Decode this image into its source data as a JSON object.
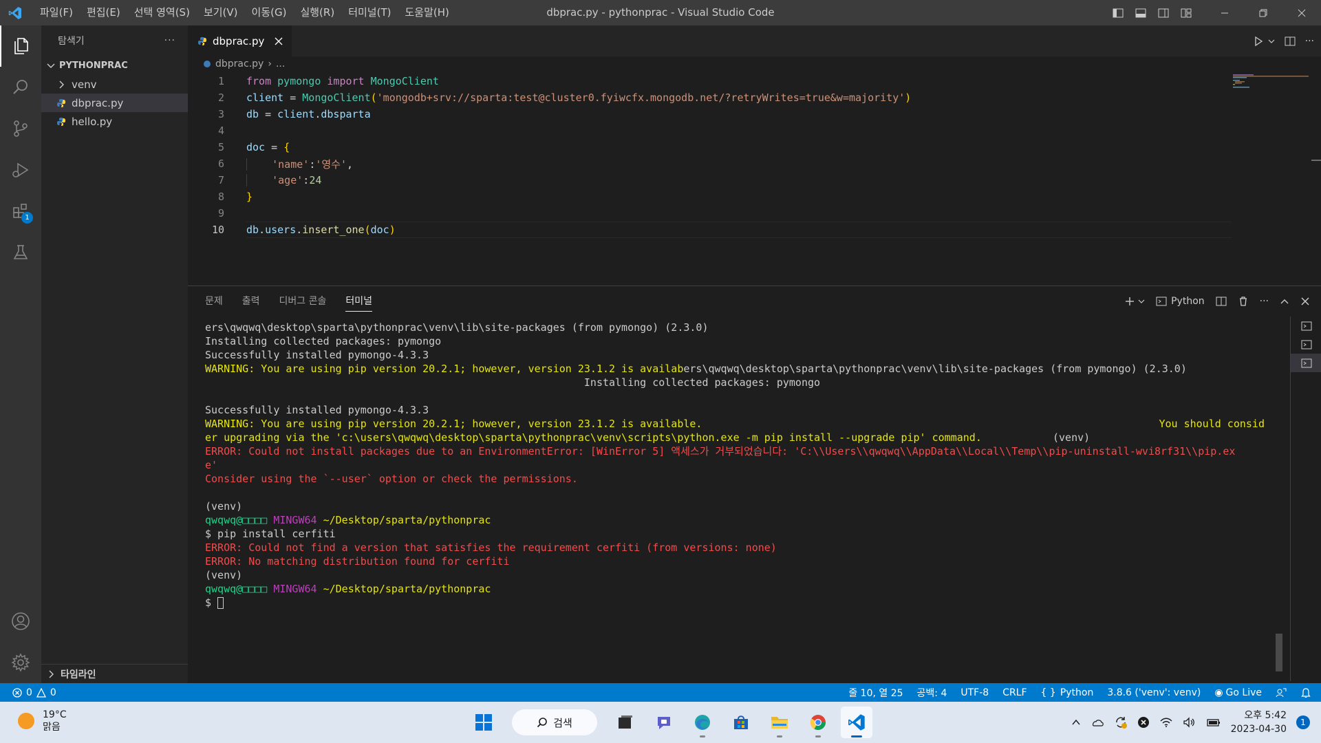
{
  "window": {
    "title": "dbprac.py - pythonprac - Visual Studio Code",
    "menu": [
      "파일(F)",
      "편집(E)",
      "선택 영역(S)",
      "보기(V)",
      "이동(G)",
      "실행(R)",
      "터미널(T)",
      "도움말(H)"
    ]
  },
  "activitybar": {
    "items": [
      "explorer-icon",
      "search-icon",
      "source-control-icon",
      "run-debug-icon",
      "extensions-icon",
      "testing-icon"
    ],
    "extensions_badge": "1",
    "bottom": [
      "accounts-icon",
      "manage-gear-icon"
    ]
  },
  "sidebar": {
    "title": "탐색기",
    "more": "···",
    "folder": "PYTHONPRAC",
    "items": [
      {
        "label": "venv",
        "type": "folder"
      },
      {
        "label": "dbprac.py",
        "type": "python-file",
        "selected": true
      },
      {
        "label": "hello.py",
        "type": "python-file"
      }
    ],
    "timeline": "타임라인"
  },
  "editor": {
    "tab": "dbprac.py",
    "breadcrumb": [
      "dbprac.py",
      "..."
    ],
    "line_numbers": [
      "1",
      "2",
      "3",
      "4",
      "5",
      "6",
      "7",
      "8",
      "9",
      "10"
    ],
    "current_line": 10,
    "code": {
      "l1": [
        "from",
        "pymongo",
        "import",
        "MongoClient"
      ],
      "l2": [
        "client",
        "=",
        "MongoClient",
        "(",
        "'mongodb+srv://sparta:test@cluster0.fyiwcfx.mongodb.net/?retryWrites=true&w=majority'",
        ")"
      ],
      "l3": [
        "db",
        "=",
        "client",
        ".",
        "dbsparta"
      ],
      "l5": [
        "doc",
        "=",
        "{"
      ],
      "l6": [
        "'name'",
        ":",
        "'영수'",
        ","
      ],
      "l7": [
        "'age'",
        ":",
        "24"
      ],
      "l8": [
        "}"
      ],
      "l10": [
        "db",
        ".",
        "users",
        ".",
        "insert_one",
        "(",
        "doc",
        ")"
      ]
    }
  },
  "panel": {
    "tabs": [
      "문제",
      "출력",
      "디버그 콘솔",
      "터미널"
    ],
    "active_tab": "터미널",
    "profile": "Python",
    "terminal_lines": [
      {
        "kind": "plain",
        "text": "ers\\qwqwq\\desktop\\sparta\\pythonprac\\venv\\lib\\site-packages (from pymongo) (2.3.0)"
      },
      {
        "kind": "plain",
        "text": "Installing collected packages: pymongo"
      },
      {
        "kind": "plain",
        "text": "Successfully installed pymongo-4.3.3"
      },
      {
        "kind": "mixed",
        "warn": "WARNING: You are using pip version 20.2.1; however, version 23.1.2 is availab",
        "plain": "ers\\qwqwq\\desktop\\sparta\\pythonprac\\venv\\lib\\site-packages (from pymongo) (2.3.0)"
      },
      {
        "kind": "plain",
        "text": "                                                             Installing collected packages: pymongo"
      },
      {
        "kind": "plain",
        "text": ""
      },
      {
        "kind": "plain",
        "text": "Successfully installed pymongo-4.3.3"
      },
      {
        "kind": "mixed2",
        "warn": "WARNING: You are using pip version 20.2.1; however, version 23.1.2 is available.",
        "warn2": "You should consid"
      },
      {
        "kind": "mixed3",
        "warn": "er upgrading via the 'c:\\users\\qwqwq\\desktop\\sparta\\pythonprac\\venv\\scripts\\python.exe -m pip install --upgrade pip' command.",
        "plain": "(venv)"
      },
      {
        "kind": "err",
        "text": "ERROR: Could not install packages due to an EnvironmentError: [WinError 5] 액세스가 거부되었습니다: 'C:\\\\Users\\\\qwqwq\\\\AppData\\\\Local\\\\Temp\\\\pip-uninstall-wvi8rf31\\\\pip.ex"
      },
      {
        "kind": "err",
        "text": "e'"
      },
      {
        "kind": "err",
        "text": "Consider using the `--user` option or check the permissions."
      },
      {
        "kind": "plain",
        "text": ""
      },
      {
        "kind": "plain",
        "text": "(venv)"
      },
      {
        "kind": "prompt",
        "user": "qwqwq@□□□□",
        "host": "MINGW64",
        "path": "~/Desktop/sparta/pythonprac"
      },
      {
        "kind": "plain",
        "text": "$ pip install cerfiti"
      },
      {
        "kind": "err",
        "text": "ERROR: Could not find a version that satisfies the requirement cerfiti (from versions: none)"
      },
      {
        "kind": "err",
        "text": "ERROR: No matching distribution found for cerfiti"
      },
      {
        "kind": "plain",
        "text": "(venv)"
      },
      {
        "kind": "prompt",
        "user": "qwqwq@□□□□",
        "host": "MINGW64",
        "path": "~/Desktop/sparta/pythonprac"
      },
      {
        "kind": "cursor",
        "text": "$ "
      }
    ]
  },
  "statusbar": {
    "errors": "0",
    "warnings": "0",
    "position": "줄 10, 열 25",
    "spaces": "공백: 4",
    "encoding": "UTF-8",
    "eol": "CRLF",
    "language": "Python",
    "interpreter": "3.8.6 ('venv': venv)",
    "golive": "Go Live"
  },
  "taskbar": {
    "temp": "19°C",
    "weather": "맑음",
    "search": "검색",
    "apps": [
      "windows-start-icon",
      "task-view-icon",
      "chat-icon",
      "edge-icon",
      "store-icon",
      "file-explorer-icon",
      "chrome-icon",
      "vscode-icon"
    ],
    "time": "오후 5:42",
    "date": "2023-04-30",
    "notifications": "1"
  },
  "colors": {
    "accent": "#007acc",
    "titlebar": "#3c3c3c",
    "activitybar": "#333333",
    "sidebar": "#252526",
    "editor": "#1e1e1e"
  }
}
